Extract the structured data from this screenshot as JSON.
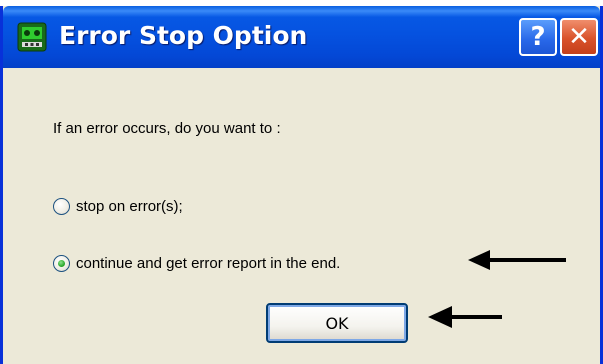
{
  "window": {
    "title": "Error Stop Option",
    "help_button": "?",
    "close_button": "✕"
  },
  "header_caption": "...",
  "prompt": "If an error occurs, do you want to :",
  "options": [
    {
      "label": "stop on error(s);",
      "selected": false
    },
    {
      "label": "continue and get error report in the end.",
      "selected": true
    }
  ],
  "ok_button": "OK",
  "colors": {
    "title_bar": "#0552e0",
    "dialog_bg": "#ece9d8",
    "close_button": "#d9522a",
    "radio_selected": "#21a121"
  }
}
